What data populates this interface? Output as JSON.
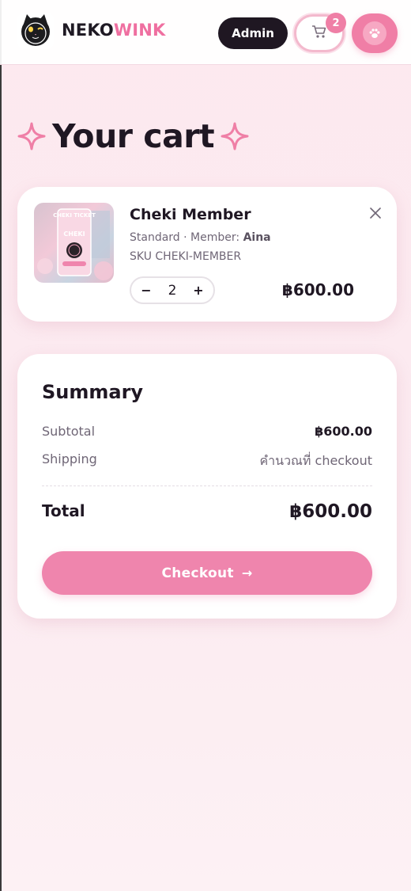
{
  "header": {
    "brand_part1": "NEKO",
    "brand_part2": "WINK",
    "admin_label": "Admin",
    "cart_count": "2",
    "logo_icon": "cat-logo-icon",
    "cart_icon": "cart-icon",
    "profile_icon": "paw-icon"
  },
  "page": {
    "title": "Your cart"
  },
  "cart_item": {
    "name": "Cheki Member",
    "variant_prefix": "Standard · Member: ",
    "variant_member": "Aina",
    "sku": "SKU CHEKI-MEMBER",
    "quantity": "2",
    "decrement_label": "−",
    "increment_label": "+",
    "price": "฿600.00",
    "thumbnail_text_top": "CHEKI TICKET",
    "thumbnail_text_mid": "CHEKI"
  },
  "summary": {
    "title": "Summary",
    "subtotal_label": "Subtotal",
    "subtotal_value": "฿600.00",
    "shipping_label": "Shipping",
    "shipping_value": "คำนวณที่ checkout",
    "total_label": "Total",
    "total_value": "฿600.00",
    "checkout_label": "Checkout",
    "checkout_arrow": "→"
  },
  "colors": {
    "accent_pink": "#ef85ad",
    "brand_pink": "#ef6fa0",
    "dark": "#1f1722",
    "background": "#fde9ef"
  }
}
